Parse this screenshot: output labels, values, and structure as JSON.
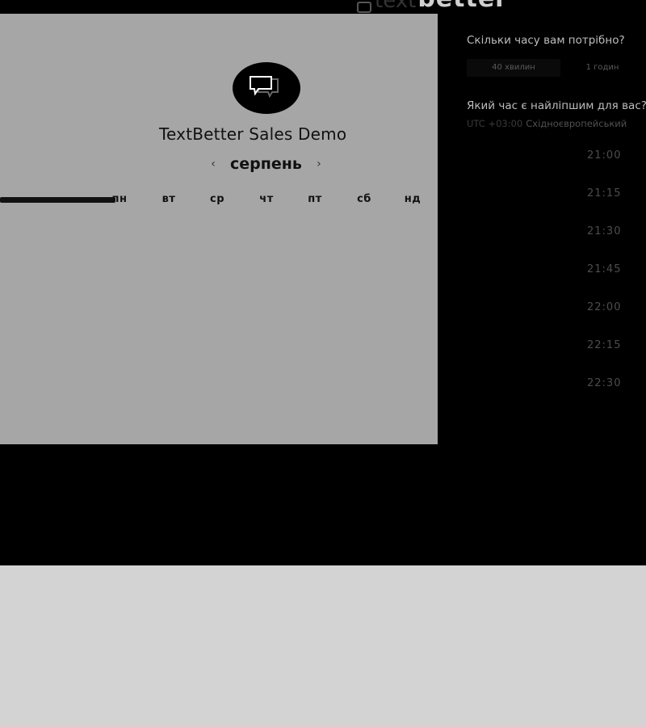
{
  "header": {
    "logo_light": "text",
    "logo_bold": "better"
  },
  "calendar": {
    "title": "TextBetter Sales Demo",
    "month": "серпень",
    "prev_arrow": "‹",
    "next_arrow": "›",
    "weekdays": [
      "пн",
      "вт",
      "ср",
      "чт",
      "пт",
      "сб",
      "нд"
    ]
  },
  "booking": {
    "duration_question": "Скільки часу вам потрібно?",
    "durations": [
      "40 хвилин",
      "1 годин"
    ],
    "time_question": "Який час є найліпшим для вас?",
    "timezone_offset": "UTC +03:00",
    "timezone_name": "Східноєвропейський",
    "slots": [
      "21:00",
      "21:15",
      "21:30",
      "21:45",
      "22:00",
      "22:15",
      "22:30"
    ]
  },
  "colors": {
    "background": "#000000",
    "panel": "#a6a6a6",
    "footer": "#d3d3d3"
  }
}
